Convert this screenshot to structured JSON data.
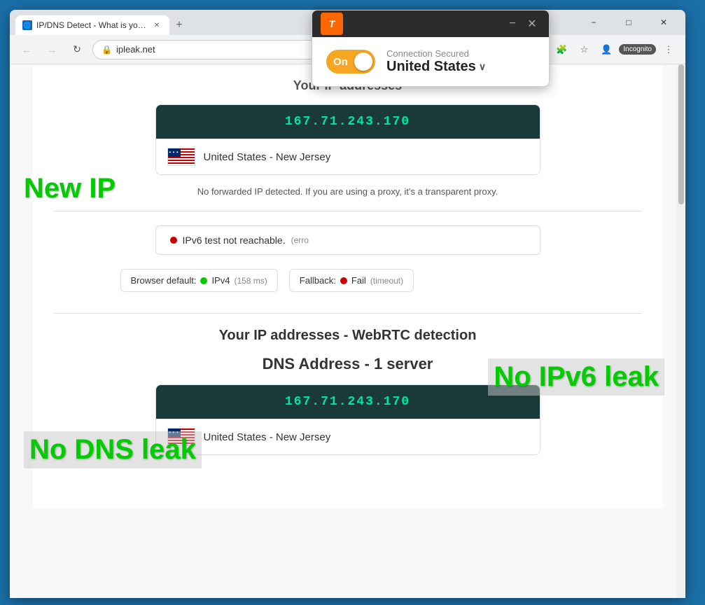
{
  "browser": {
    "tab": {
      "label": "IP/DNS Detect - What is your IP,",
      "favicon": "IP"
    },
    "new_tab_label": "+",
    "window_controls": {
      "minimize": "−",
      "maximize": "□",
      "close": "✕"
    },
    "address_bar": {
      "url": "ipleak.net",
      "back": "←",
      "forward": "→",
      "refresh": "↻"
    },
    "toolbar_icons": {
      "incognito": "Incognito"
    }
  },
  "vpn": {
    "logo": "T",
    "status": "On",
    "connection_secured": "Connection Secured",
    "country": "United States",
    "close": "✕",
    "minimize": "−"
  },
  "page": {
    "ip_section": {
      "title": "Your IP addresses",
      "ip_address": "167.71.243.170",
      "location": "United States - New Jersey",
      "no_forwarded": "No forwarded IP detected. If you are using a proxy, it's a transparent proxy."
    },
    "ipv6_section": {
      "status": "IPv6 test not reachable.",
      "error_note": "(erro"
    },
    "connection_tests": {
      "browser_default_label": "Browser default:",
      "browser_default_proto": "IPv4",
      "browser_default_ms": "(158 ms)",
      "fallback_label": "Fallback:",
      "fallback_status": "Fail",
      "fallback_note": "(timeout)"
    },
    "webrtc_section": {
      "title": "Your IP addresses - WebRTC detection"
    },
    "dns_section": {
      "title": "DNS Address - 1 server",
      "ip_address": "167.71.243.170",
      "location": "United States - New Jersey"
    }
  },
  "overlays": {
    "new_ip": "New IP",
    "no_ipv6": "No IPv6 leak",
    "no_dns": "No DNS leak"
  }
}
